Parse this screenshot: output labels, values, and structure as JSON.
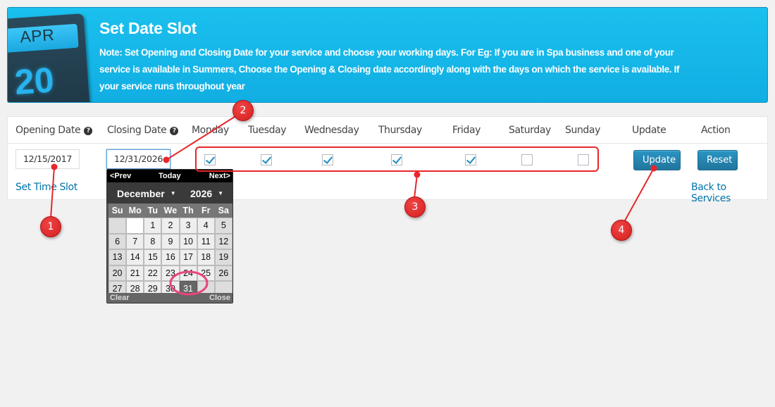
{
  "banner": {
    "icon": {
      "name": "calendar-icon",
      "month": "APR",
      "day": "20"
    },
    "title": "Set Date Slot",
    "note": "Note: Set Opening and Closing Date for your service and choose your working days. For Eg: If you are in Spa business and one of your service is available in Summers, Choose the Opening & Closing date accordingly along with the days on which the service is available. If your service runs throughout year"
  },
  "table": {
    "headers": {
      "opening_date": "Opening Date",
      "closing_date": "Closing Date",
      "monday": "Monday",
      "tuesday": "Tuesday",
      "wednesday": "Wednesday",
      "thursday": "Thursday",
      "friday": "Friday",
      "saturday": "Saturday",
      "sunday": "Sunday",
      "update": "Update",
      "action": "Action"
    },
    "help_icon": "?",
    "opening_date_value": "12/15/2017",
    "closing_date_value": "12/31/2026",
    "days": [
      {
        "name": "Monday",
        "checked": true
      },
      {
        "name": "Tuesday",
        "checked": true
      },
      {
        "name": "Wednesday",
        "checked": true
      },
      {
        "name": "Thursday",
        "checked": true
      },
      {
        "name": "Friday",
        "checked": true
      },
      {
        "name": "Saturday",
        "checked": false
      },
      {
        "name": "Sunday",
        "checked": false
      }
    ],
    "update_button": "Update",
    "reset_button": "Reset",
    "set_time_slot_link": "Set Time Slot",
    "back_link": "Back to Services"
  },
  "datepicker": {
    "prev": "<Prev",
    "today": "Today",
    "next": "Next>",
    "month": "December",
    "year": "2026",
    "caret": "▼",
    "dow": [
      "Su",
      "Mo",
      "Tu",
      "We",
      "Th",
      "Fr",
      "Sa"
    ],
    "weeks": [
      [
        "",
        "",
        "1",
        "2",
        "3",
        "4",
        "5"
      ],
      [
        "6",
        "7",
        "8",
        "9",
        "10",
        "11",
        "12"
      ],
      [
        "13",
        "14",
        "15",
        "16",
        "17",
        "18",
        "19"
      ],
      [
        "20",
        "21",
        "22",
        "23",
        "24",
        "25",
        "26"
      ],
      [
        "27",
        "28",
        "29",
        "30",
        "31",
        "",
        ""
      ]
    ],
    "selected": "31",
    "clear": "Clear",
    "close": "Close"
  },
  "annotations": {
    "markers": [
      "1",
      "2",
      "3",
      "4"
    ],
    "color": "#e8262a",
    "highlight_color": "#e8457a"
  }
}
